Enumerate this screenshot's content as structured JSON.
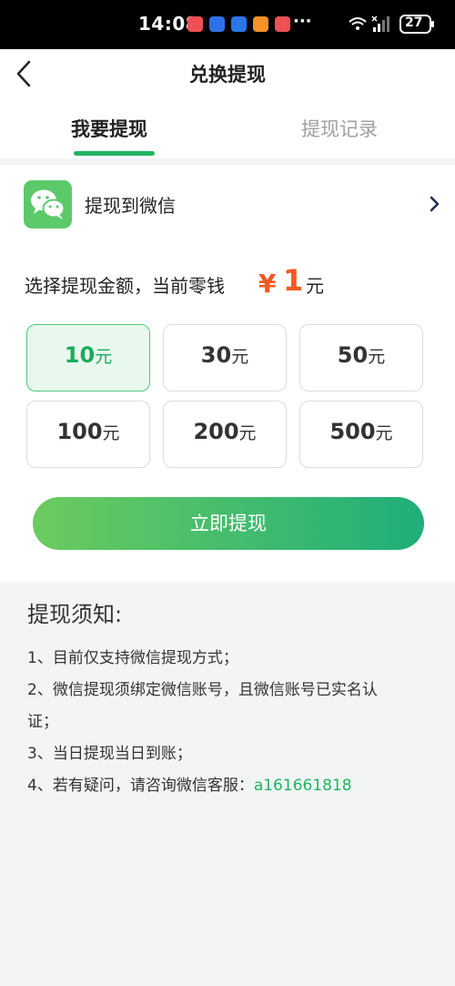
{
  "status_bar": {
    "time": "14:08",
    "dots": "···",
    "battery": "27",
    "app_icons": [
      "#f04f56",
      "#2f6fe8",
      "#2a76e6",
      "#f7922a",
      "#f04f56"
    ]
  },
  "header": {
    "title": "兑换提现"
  },
  "tabs": [
    {
      "label": "我要提现",
      "active": true
    },
    {
      "label": "提现记录",
      "active": false
    }
  ],
  "method": {
    "label": "提现到微信"
  },
  "amount": {
    "prompt": "选择提现金额，当前零钱",
    "currency": "¥",
    "balance": "1",
    "unit": "元"
  },
  "options": [
    {
      "value": "10",
      "unit": "元",
      "selected": true
    },
    {
      "value": "30",
      "unit": "元",
      "selected": false
    },
    {
      "value": "50",
      "unit": "元",
      "selected": false
    },
    {
      "value": "100",
      "unit": "元",
      "selected": false
    },
    {
      "value": "200",
      "unit": "元",
      "selected": false
    },
    {
      "value": "500",
      "unit": "元",
      "selected": false
    }
  ],
  "submit": {
    "label": "立即提现"
  },
  "notice": {
    "title": "提现须知:",
    "line1": "1、目前仅支持微信提现方式；",
    "line2": "2、微信提现须绑定微信账号，且微信账号已实名认",
    "line2b": "证；",
    "line3": "3、当日提现当日到账；",
    "line4_prefix": "4、若有疑问，请咨询微信客服：",
    "line4_id": "a161661818"
  },
  "colors": {
    "accent": "#1fb560",
    "price": "#f05a24",
    "wechat": "#5cc96b"
  }
}
